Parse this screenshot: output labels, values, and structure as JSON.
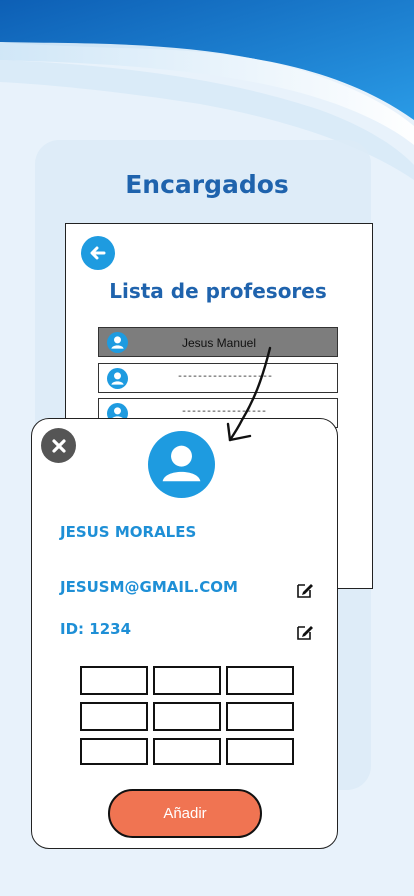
{
  "screen": {
    "title": "Encargados"
  },
  "list": {
    "title": "Lista de profesores",
    "rows": [
      {
        "name": "Jesus Manuel",
        "selected": true
      },
      {
        "name": "-------------------",
        "selected": false
      },
      {
        "name": "-----------------",
        "selected": false
      }
    ]
  },
  "detail": {
    "name": "JESUS MORALES",
    "email": "JESUSM@GMAIL.COM",
    "id": "ID: 1234",
    "add_label": "Añadir"
  },
  "icons": {
    "back": "arrow-left-circle-icon",
    "close": "close-circle-icon",
    "avatar": "user-circle-icon",
    "edit": "edit-pencil-icon"
  },
  "colors": {
    "title": "#1f63ad",
    "accent": "#1e9be0",
    "detail_text": "#1e8fd6",
    "add_button": "#f07452",
    "selected_row": "#7d7d7d"
  }
}
